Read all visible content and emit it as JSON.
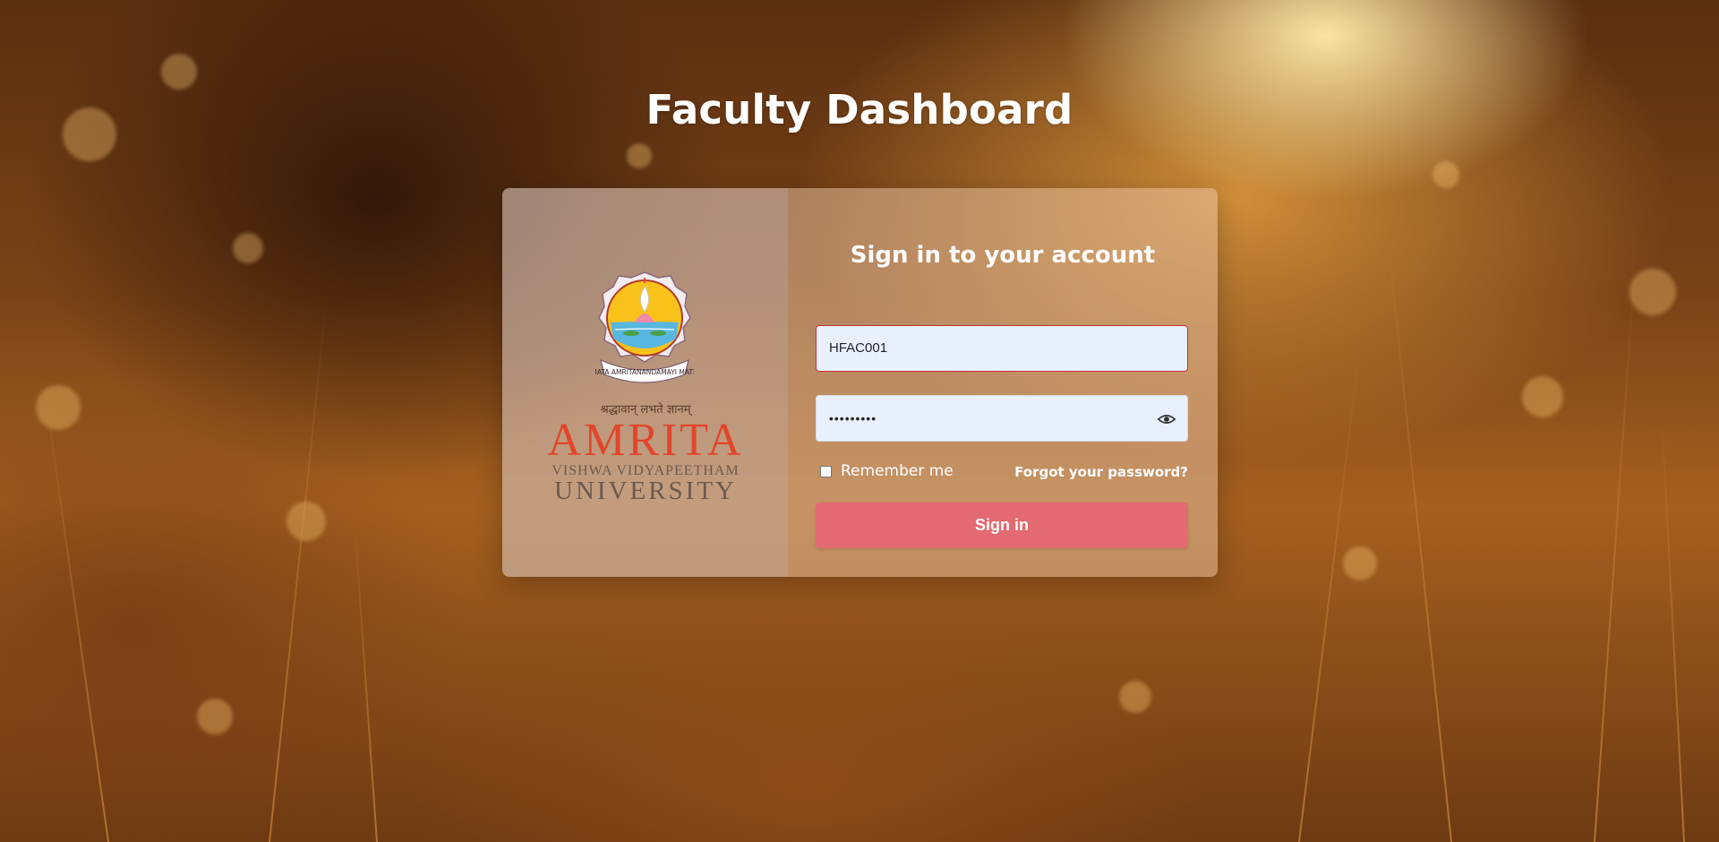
{
  "page": {
    "title": "Faculty Dashboard"
  },
  "logo": {
    "seal_banner_text": "MATA AMRITANANDAMAYI MATH",
    "motto": "श्रद्धावान् लभते ज्ञानम्",
    "name_line1": "AMRITA",
    "name_line2": "VISHWA VIDYAPEETHAM",
    "name_line3": "UNIVERSITY",
    "accent_color": "#e2452a"
  },
  "login": {
    "heading": "Sign in to your account",
    "username_value": "HFAC001",
    "password_value": "•••••••••",
    "password_toggle_icon": "eye-icon",
    "remember_label": "Remember me",
    "remember_checked": false,
    "forgot_label": "Forgot your password?",
    "signin_label": "Sign in",
    "signin_color": "#e26a70",
    "error_border_color": "#c8323a"
  }
}
